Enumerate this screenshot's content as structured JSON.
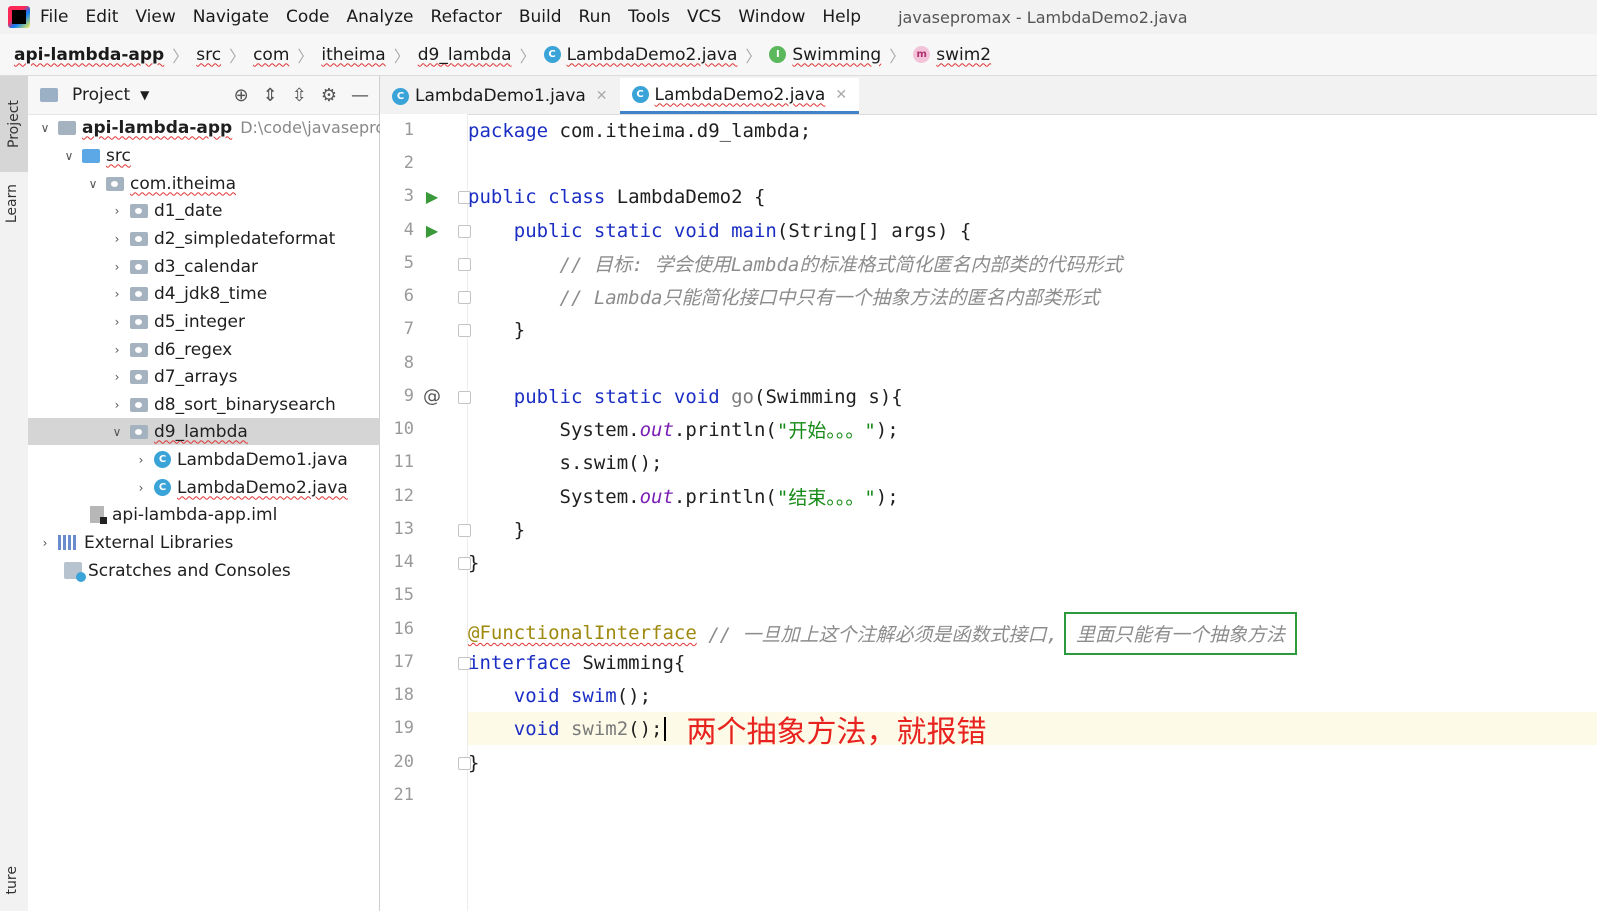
{
  "menubar": {
    "items": [
      "File",
      "Edit",
      "View",
      "Navigate",
      "Code",
      "Analyze",
      "Refactor",
      "Build",
      "Run",
      "Tools",
      "VCS",
      "Window",
      "Help"
    ],
    "window_title": "javasepromax - LambdaDemo2.java"
  },
  "breadcrumb": [
    "api-lambda-app",
    "src",
    "com",
    "itheima",
    "d9_lambda",
    "LambdaDemo2.java",
    "Swimming",
    "swim2"
  ],
  "toolstrip": {
    "project": "Project",
    "learn": "Learn",
    "structure": "ture"
  },
  "project_panel": {
    "title": "Project",
    "root": {
      "name": "api-lambda-app",
      "path": "D:\\code\\javasepro"
    },
    "src": "src",
    "package": "com.itheima",
    "folders": [
      "d1_date",
      "d2_simpledateformat",
      "d3_calendar",
      "d4_jdk8_time",
      "d5_integer",
      "d6_regex",
      "d7_arrays",
      "d8_sort_binarysearch",
      "d9_lambda"
    ],
    "files": [
      "LambdaDemo1.java",
      "LambdaDemo2.java"
    ],
    "iml": "api-lambda-app.iml",
    "external_libraries": "External Libraries",
    "scratches": "Scratches and Consoles"
  },
  "tabs": [
    {
      "label": "LambdaDemo1.java",
      "active": false
    },
    {
      "label": "LambdaDemo2.java",
      "active": true
    }
  ],
  "code": {
    "l1": [
      "package",
      " com.itheima.d9_lambda;"
    ],
    "l3": [
      "public class",
      " LambdaDemo2 {"
    ],
    "l4": [
      "    public static void",
      " main",
      "(String[] args) {"
    ],
    "l5": "        // 目标: 学会使用Lambda的标准格式简化匿名内部类的代码形式",
    "l6": "        // Lambda只能简化接口中只有一个抽象方法的匿名内部类形式",
    "l7": "    }",
    "l9": [
      "    public static void",
      " go",
      "(Swimming s){"
    ],
    "l10": [
      "        System.",
      "out",
      ".println(",
      "\"开始。。。\"",
      ");"
    ],
    "l11": "        s.swim();",
    "l12": [
      "        System.",
      "out",
      ".println(",
      "\"结束。。。\"",
      ");"
    ],
    "l13": "    }",
    "l14": "}",
    "l16": [
      "@FunctionalInterface",
      " // 一旦加上这个注解必须是函数式接口,",
      "里面只能有一个抽象方法"
    ],
    "l17": [
      "interface",
      " Swimming{"
    ],
    "l18": [
      "    void",
      " swim",
      "();"
    ],
    "l19": [
      "    void",
      " swim2",
      "();"
    ],
    "l19_note": "两个抽象方法，就报错",
    "l20": "}"
  },
  "line_numbers": [
    "1",
    "2",
    "3",
    "4",
    "5",
    "6",
    "7",
    "8",
    "9",
    "10",
    "11",
    "12",
    "13",
    "14",
    "15",
    "16",
    "17",
    "18",
    "19",
    "20",
    "21"
  ]
}
